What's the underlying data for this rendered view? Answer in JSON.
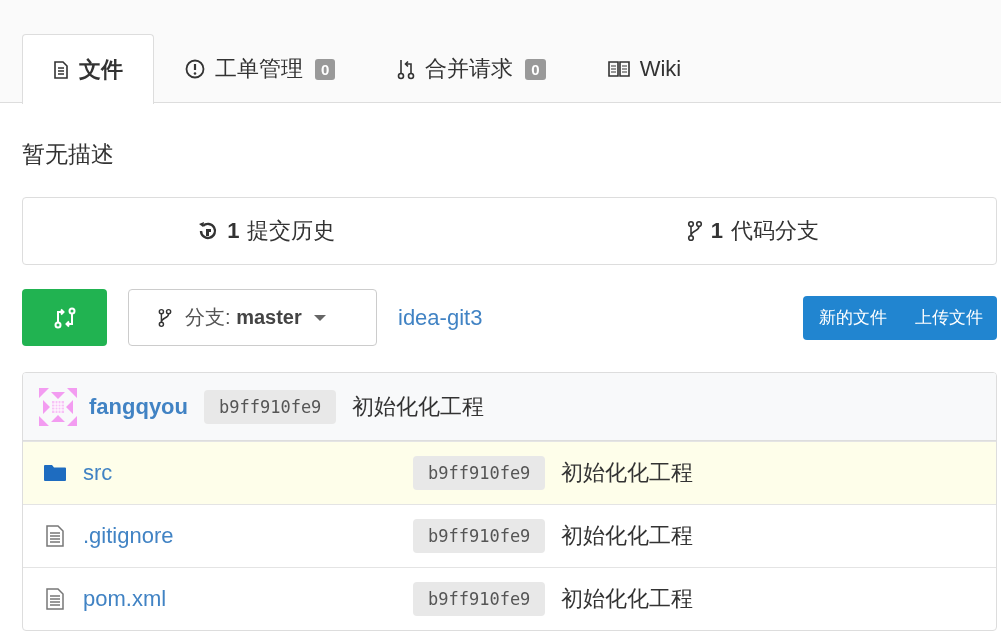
{
  "tabs": [
    {
      "kind": "files",
      "label": "文件",
      "selected": true
    },
    {
      "kind": "issues",
      "label": "工单管理",
      "badge": "0",
      "selected": false
    },
    {
      "kind": "pulls",
      "label": "合并请求",
      "badge": "0",
      "selected": false
    },
    {
      "kind": "wiki",
      "label": "Wiki",
      "selected": false
    }
  ],
  "description": "暂无描述",
  "stats": [
    {
      "kind": "commits",
      "count": "1",
      "label": "提交历史"
    },
    {
      "kind": "branches",
      "count": "1",
      "label": "代码分支"
    }
  ],
  "toolbar": {
    "branch_label": "分支:",
    "branch": "master",
    "repo_link": "idea-git3",
    "buttons": [
      "新的文件",
      "上传文件"
    ]
  },
  "latest_commit": {
    "author": "fangqyou",
    "hash": "b9ff910fe9",
    "message": "初始化化工程"
  },
  "files": [
    {
      "kind": "folder",
      "name": "src",
      "hash": "b9ff910fe9",
      "message": "初始化化工程",
      "highlighted": true
    },
    {
      "kind": "file",
      "name": ".gitignore",
      "hash": "b9ff910fe9",
      "message": "初始化化工程",
      "highlighted": false
    },
    {
      "kind": "file",
      "name": "pom.xml",
      "hash": "b9ff910fe9",
      "message": "初始化化工程",
      "highlighted": false
    }
  ]
}
